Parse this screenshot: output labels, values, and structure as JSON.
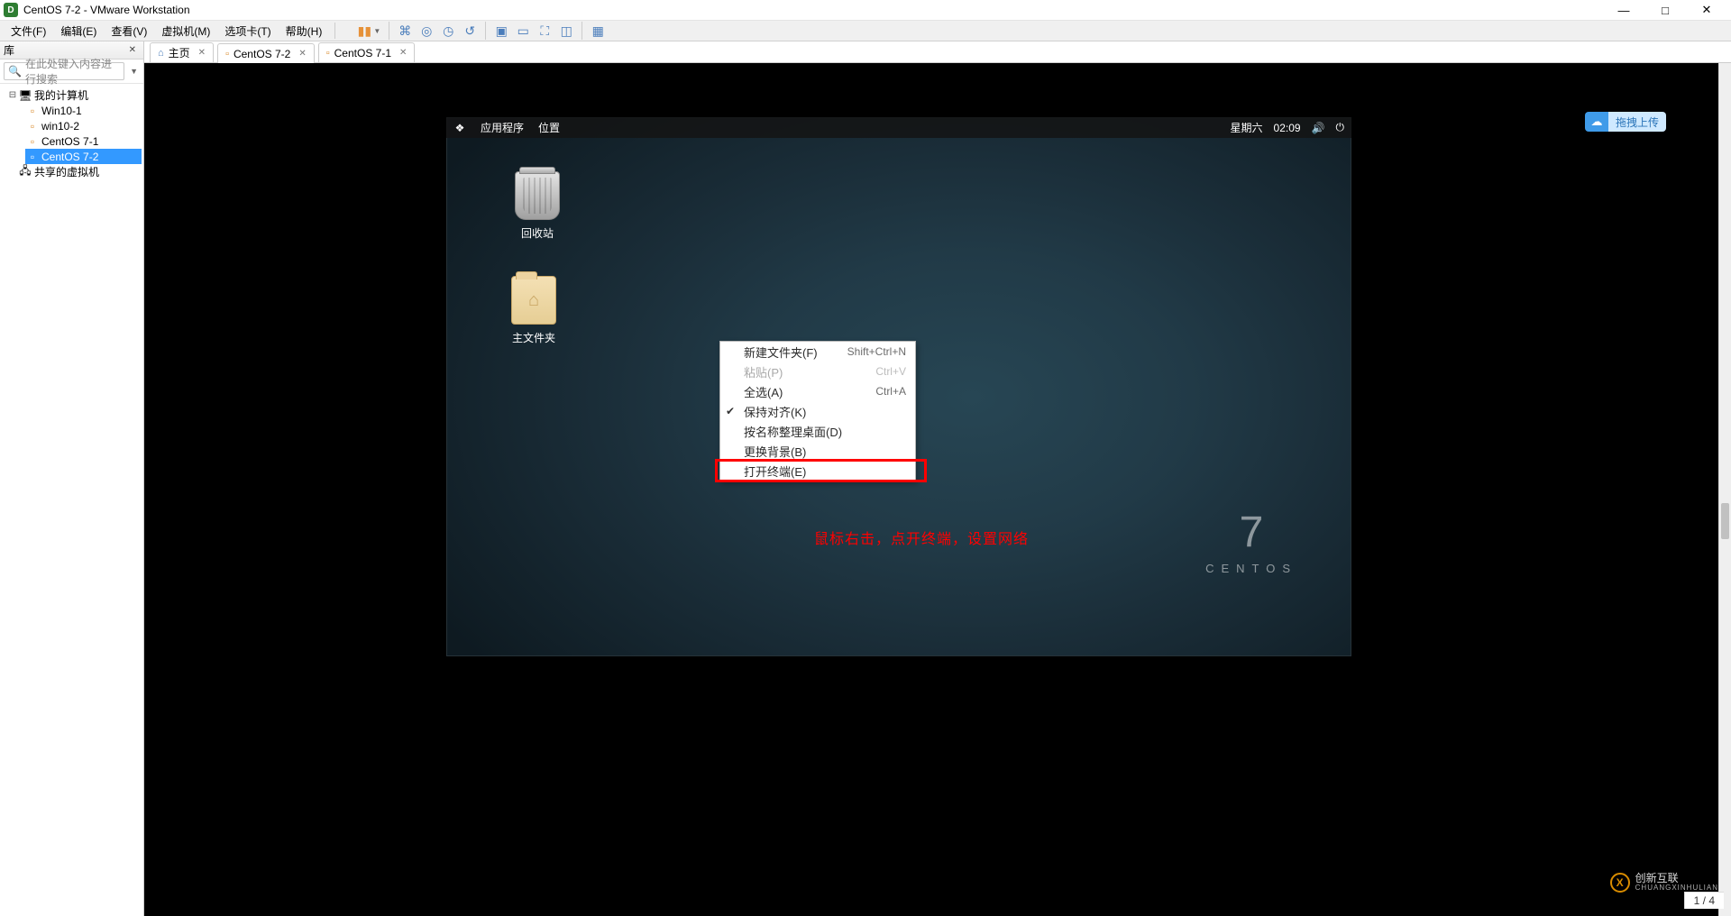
{
  "titlebar": {
    "app_icon_letter": "D",
    "title": "CentOS 7-2 - VMware Workstation"
  },
  "win_controls": {
    "min": "—",
    "max": "□",
    "close": "✕"
  },
  "menubar": {
    "items": [
      "文件(F)",
      "编辑(E)",
      "查看(V)",
      "虚拟机(M)",
      "选项卡(T)",
      "帮助(H)"
    ]
  },
  "sidebar": {
    "header": "库",
    "search_placeholder": "在此处键入内容进行搜索",
    "tree": {
      "root": "我的计算机",
      "children": [
        "Win10-1",
        "win10-2",
        "CentOS 7-1",
        "CentOS 7-2"
      ],
      "selected": "CentOS 7-2",
      "shared": "共享的虚拟机"
    }
  },
  "tabs": [
    {
      "label": "主页",
      "type": "home",
      "active": false
    },
    {
      "label": "CentOS 7-2",
      "type": "vm",
      "active": true
    },
    {
      "label": "CentOS 7-1",
      "type": "vm",
      "active": false
    }
  ],
  "guest": {
    "topbar": {
      "apps": "应用程序",
      "places": "位置",
      "day": "星期六",
      "time": "02:09"
    },
    "desktop_icons": {
      "trash": "回收站",
      "home": "主文件夹"
    },
    "context_menu": [
      {
        "label": "新建文件夹(F)",
        "shortcut": "Shift+Ctrl+N",
        "disabled": false
      },
      {
        "label": "粘贴(P)",
        "shortcut": "Ctrl+V",
        "disabled": true
      },
      {
        "label": "全选(A)",
        "shortcut": "Ctrl+A",
        "disabled": false
      },
      {
        "label": "保持对齐(K)",
        "shortcut": "",
        "disabled": false,
        "checked": true
      },
      {
        "label": "按名称整理桌面(D)",
        "shortcut": "",
        "disabled": false
      },
      {
        "label": "更换背景(B)",
        "shortcut": "",
        "disabled": false
      },
      {
        "label": "打开终端(E)",
        "shortcut": "",
        "disabled": false,
        "highlighted": true
      }
    ],
    "annotation": "鼠标右击，点开终端，设置网络",
    "brand_num": "7",
    "brand_word": "CENTOS"
  },
  "ext_badge": {
    "text": "拖拽上传"
  },
  "page_indicator": "1 / 4",
  "watermark": {
    "glyph": "X",
    "line1": "创新互联",
    "line2": "CHUANGXINHULIAN"
  }
}
